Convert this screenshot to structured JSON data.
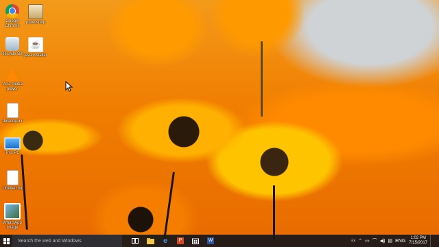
{
  "desktop": {
    "icons": [
      {
        "id": "chrome",
        "label": "Google Chrome",
        "icon": "chrome-icon"
      },
      {
        "id": "photoshop",
        "label": "photoshop",
        "icon": "file-icon"
      },
      {
        "id": "recycle",
        "label": "Recycle Bin",
        "icon": "recycle-bin-icon"
      },
      {
        "id": "java",
        "label": "java installer",
        "icon": "java-icon"
      },
      {
        "id": "vlc",
        "label": "VLC media player",
        "icon": "vlc-icon"
      },
      {
        "id": "doc1",
        "label": "desktop.ini",
        "icon": "document-icon"
      },
      {
        "id": "thispc",
        "label": "This PC",
        "icon": "computer-icon"
      },
      {
        "id": "doc2",
        "label": "Untitled.txt",
        "icon": "document-icon"
      },
      {
        "id": "whatsapp",
        "label": "WhatsApp Image",
        "icon": "image-icon"
      }
    ],
    "cursor": "arrow-cursor"
  },
  "taskbar": {
    "search_placeholder": "Search the web and Windows",
    "apps": [
      "task-view-icon",
      "file-explorer-icon",
      "edge-icon",
      "powerpoint-icon",
      "store-icon",
      "word-icon"
    ],
    "tray": {
      "language": "ENG",
      "time": "1:02 PM",
      "date": "7/15/2017"
    }
  },
  "colors": {
    "taskbar": "#16161a",
    "flower": "#ff9f00",
    "flower_center": "#2a1a0a"
  }
}
